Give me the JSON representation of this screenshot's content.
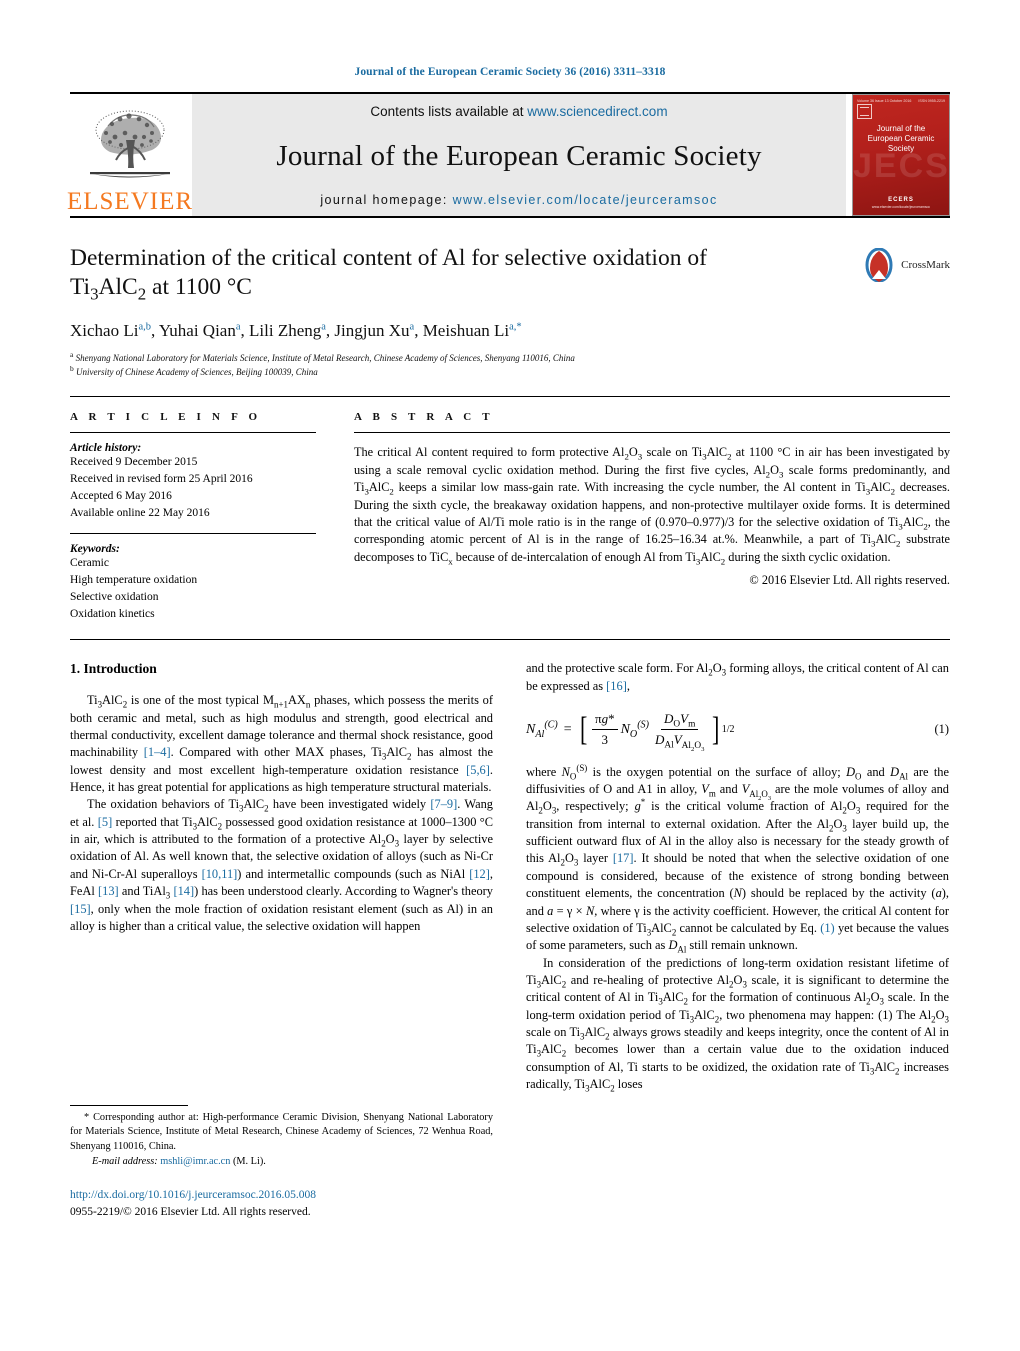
{
  "running_head": "Journal of the European Ceramic Society 36 (2016) 3311–3318",
  "masthead": {
    "publisher_logo_text": "ELSEVIER",
    "contents_prefix": "Contents lists available at ",
    "contents_link": "www.sciencedirect.com",
    "journal_name": "Journal of the European Ceramic Society",
    "homepage_prefix": "journal homepage: ",
    "homepage_link": "www.elsevier.com/locate/jeurceramsoc",
    "cover": {
      "title": "Journal of the\nEuropean Ceramic Society",
      "ghost_text": "JECS",
      "footer_brand": "ECERS",
      "footer_url": "www.elsevier.com/locate/jeurceramsoc",
      "top_left": "Volume 36 Issue 13 October 2016",
      "top_right": "ISSN 0955-2219",
      "bg_color": "#b3201c"
    }
  },
  "article": {
    "title_line1": "Determination of the critical content of Al for selective oxidation of",
    "title_line2_parts": [
      "Ti",
      "3",
      "AlC",
      "2",
      " at 1100 °C"
    ],
    "crossmark_label": "CrossMark",
    "authors": [
      {
        "name": "Xichao Li",
        "sup": "a,b"
      },
      {
        "name": "Yuhai Qian",
        "sup": "a"
      },
      {
        "name": "Lili Zheng",
        "sup": "a"
      },
      {
        "name": "Jingjun Xu",
        "sup": "a"
      },
      {
        "name": "Meishuan Li",
        "sup": "a,*"
      }
    ],
    "affiliations": [
      {
        "marker": "a",
        "text": "Shenyang National Laboratory for Materials Science, Institute of Metal Research, Chinese Academy of Sciences, Shenyang 110016, China"
      },
      {
        "marker": "b",
        "text": "University of Chinese Academy of Sciences, Beijing 100039, China"
      }
    ]
  },
  "article_info": {
    "heading": "A R T I C L E   I N F O",
    "history_label": "Article history:",
    "history": [
      "Received 9 December 2015",
      "Received in revised form 25 April 2016",
      "Accepted 6 May 2016",
      "Available online 22 May 2016"
    ],
    "keywords_label": "Keywords:",
    "keywords": [
      "Ceramic",
      "High temperature oxidation",
      "Selective oxidation",
      "Oxidation kinetics"
    ]
  },
  "abstract": {
    "heading": "A B S T R A C T",
    "paragraph_html": "The critical Al content required to form protective Al<sub>2</sub>O<sub>3</sub> scale on Ti<sub>3</sub>AlC<sub>2</sub> at 1100 °C in air has been investigated by using a scale removal cyclic oxidation method. During the first five cycles, Al<sub>2</sub>O<sub>3</sub> scale forms predominantly, and Ti<sub>3</sub>AlC<sub>2</sub> keeps a similar low mass-gain rate. With increasing the cycle number, the Al content in Ti<sub>3</sub>AlC<sub>2</sub> decreases. During the sixth cycle, the breakaway oxidation happens, and non-protective multilayer oxide forms. It is determined that the critical value of Al/Ti mole ratio is in the range of (0.970–0.977)/3 for the selective oxidation of Ti<sub>3</sub>AlC<sub>2</sub>, the corresponding atomic percent of Al is in the range of 16.25–16.34 at.%. Meanwhile, a part of Ti<sub>3</sub>AlC<sub>2</sub> substrate decomposes to TiC<sub>x</sub> because of de-intercalation of enough Al from Ti<sub>3</sub>AlC<sub>2</sub> during the sixth cyclic oxidation.",
    "copyright": "© 2016 Elsevier Ltd. All rights reserved."
  },
  "body": {
    "section_number_title": "1.  Introduction",
    "left_paragraph_1_html": "Ti<sub>3</sub>AlC<sub>2</sub> is one of the most typical M<sub>n+1</sub>AX<sub>n</sub> phases, which possess the merits of both ceramic and metal, such as high modulus and strength, good electrical and thermal conductivity, excellent damage tolerance and thermal shock resistance, good machinability <span class=\"ref\">[1–4]</span>. Compared with other MAX phases, Ti<sub>3</sub>AlC<sub>2</sub> has almost the lowest density and most excellent high-temperature oxidation resistance <span class=\"ref\">[5,6]</span>. Hence, it has great potential for applications as high temperature structural materials.",
    "left_paragraph_2_html": "The oxidation behaviors of Ti<sub>3</sub>AlC<sub>2</sub> have been investigated widely <span class=\"ref\">[7–9]</span>. Wang et al. <span class=\"ref\">[5]</span> reported that Ti<sub>3</sub>AlC<sub>2</sub> possessed good oxidation resistance at 1000–1300 °C in air, which is attributed to the formation of a protective Al<sub>2</sub>O<sub>3</sub> layer by selective oxidation of Al. As well known that, the selective oxidation of alloys (such as Ni-Cr and Ni-Cr-Al superalloys <span class=\"ref\">[10,11]</span>) and intermetallic compounds (such as NiAl <span class=\"ref\">[12]</span>, FeAl <span class=\"ref\">[13]</span> and TiAl<sub>3</sub> <span class=\"ref\">[14]</span>) has been understood clearly. According to Wagner's theory <span class=\"ref\">[15]</span>, only when the mole fraction of oxidation resistant element (such as Al) in an alloy is higher than a critical value, the selective oxidation will happen",
    "right_paragraph_1_html": "and the protective scale form. For Al<sub>2</sub>O<sub>3</sub> forming alloys, the critical content of Al can be expressed as <span class=\"ref\">[16]</span>,",
    "equation_number": "(1)",
    "right_paragraph_2_html": "where <span class=\"var\">N</span><sub>O</sub><sup>(S)</sup> is the oxygen potential on the surface of alloy; <span class=\"var\">D</span><sub>O</sub> and <span class=\"var\">D</span><sub>Al</sub> are the diffusivities of O and A1 in alloy, <span class=\"var\">V</span><sub>m</sub> and <span class=\"var\">V</span><sub>Al<sub>2</sub>O<sub>3</sub></sub> are the mole volumes of alloy and Al<sub>2</sub>O<sub>3</sub>, respectively; <span class=\"var\">g</span><sup>*</sup> is the critical volume fraction of Al<sub>2</sub>O<sub>3</sub> required for the transition from internal to external oxidation. After the Al<sub>2</sub>O<sub>3</sub> layer build up, the sufficient outward flux of Al in the alloy also is necessary for the steady growth of this Al<sub>2</sub>O<sub>3</sub> layer <span class=\"ref\">[17]</span>. It should be noted that when the selective oxidation of one compound is considered, because of the existence of strong bonding between constituent elements, the concentration (<span class=\"var\">N</span>) should be replaced by the activity (<span class=\"var\">a</span>), and <span class=\"var\">a</span> = γ × <span class=\"var\">N</span>, where γ is the activity coefficient. However, the critical Al content for selective oxidation of Ti<sub>3</sub>AlC<sub>2</sub> cannot be calculated by Eq. <span class=\"ref\">(1)</span> yet because the values of some parameters, such as <span class=\"var\">D</span><sub>Al</sub> still remain unknown.",
    "right_paragraph_3_html": "In consideration of the predictions of long-term oxidation resistant lifetime of Ti<sub>3</sub>AlC<sub>2</sub> and re-healing of protective Al<sub>2</sub>O<sub>3</sub> scale, it is significant to determine the critical content of Al in Ti<sub>3</sub>AlC<sub>2</sub> for the formation of continuous Al<sub>2</sub>O<sub>3</sub> scale. In the long-term oxidation period of Ti<sub>3</sub>AlC<sub>2</sub>, two phenomena may happen: (1) The Al<sub>2</sub>O<sub>3</sub> scale on Ti<sub>3</sub>AlC<sub>2</sub> always grows steadily and keeps integrity, once the content of Al in Ti<sub>3</sub>AlC<sub>2</sub> becomes lower than a certain value due to the oxidation induced consumption of Al, Ti starts to be oxidized, the oxidation rate of Ti<sub>3</sub>AlC<sub>2</sub> increases radically, Ti<sub>3</sub>AlC<sub>2</sub> loses"
  },
  "footnote": {
    "text": "*  Corresponding author at: High-performance Ceramic Division, Shenyang National Laboratory for Materials Science, Institute of Metal Research, Chinese Academy of Sciences, 72 Wenhua Road, Shenyang 110016, China.",
    "email_label": "E-mail address:",
    "email": "mshli@imr.ac.cn",
    "email_suffix": "(M. Li)."
  },
  "footer": {
    "doi": "http://dx.doi.org/10.1016/j.jeurceramsoc.2016.05.008",
    "issn_copyright": "0955-2219/© 2016 Elsevier Ltd. All rights reserved."
  },
  "colors": {
    "link_blue": "#1a6ba0",
    "elsevier_orange": "#F47920",
    "cover_red": "#b3201c"
  }
}
